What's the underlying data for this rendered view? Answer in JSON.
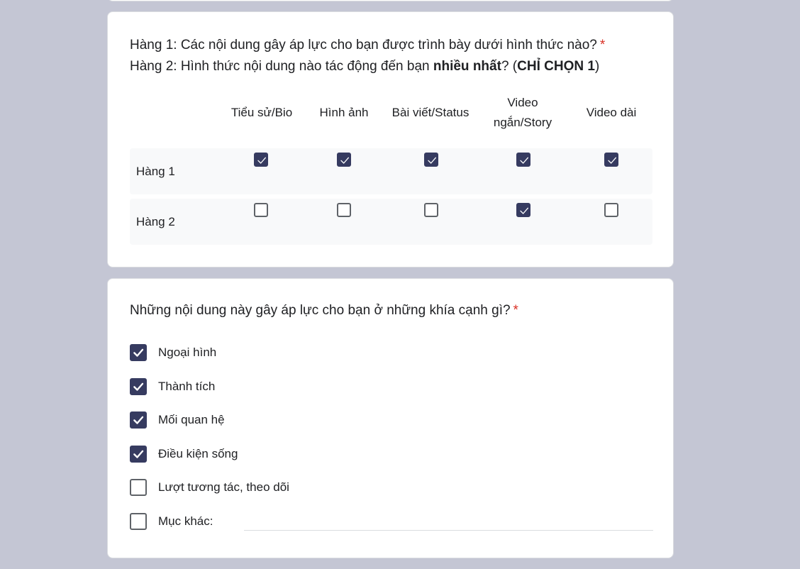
{
  "question1": {
    "line1": "Hàng 1: Các nội dung gây áp lực cho bạn được trình bày dưới hình thức nào?",
    "required_mark": "*",
    "line2_prefix": "Hàng 2: Hình thức nội dung nào tác động đến bạn ",
    "line2_bold1": "nhiều nhất",
    "line2_mid": "? (",
    "line2_bold2": "CHỈ CHỌN 1",
    "line2_suffix": ")",
    "columns": [
      {
        "line1": "Tiểu sử/Bio",
        "line2": ""
      },
      {
        "line1": "Hình ảnh",
        "line2": ""
      },
      {
        "line1": "Bài viết/Status",
        "line2": ""
      },
      {
        "line1": "Video",
        "line2": "ngắn/Story"
      },
      {
        "line1": "Video dài",
        "line2": ""
      }
    ],
    "rows": [
      {
        "label": "Hàng 1",
        "checked": [
          true,
          true,
          true,
          true,
          true
        ]
      },
      {
        "label": "Hàng 2",
        "checked": [
          false,
          false,
          false,
          true,
          false
        ]
      }
    ]
  },
  "question2": {
    "title": "Những nội dung này gây áp lực cho bạn ở những khía cạnh gì?",
    "required_mark": "*",
    "options": [
      {
        "label": "Ngoại hình",
        "checked": true
      },
      {
        "label": "Thành tích",
        "checked": true
      },
      {
        "label": "Mối quan hệ",
        "checked": true
      },
      {
        "label": "Điều kiện sống",
        "checked": true
      },
      {
        "label": "Lượt tương tác, theo dõi",
        "checked": false
      },
      {
        "label": "Mục khác:",
        "checked": false
      }
    ],
    "other_value": ""
  },
  "colors": {
    "accent": "#363b60",
    "background": "#c4c6d4",
    "required": "#d93025"
  },
  "icons": {
    "check": "checkmark-icon"
  }
}
